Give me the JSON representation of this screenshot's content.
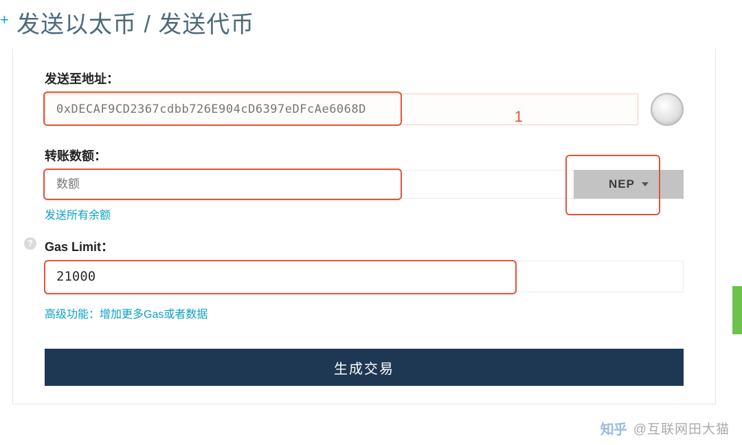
{
  "title": "发送以太币 / 发送代币",
  "address": {
    "label": "发送至地址：",
    "placeholder": "0xDECAF9CD2367cdbb726E904cD6397eDFcAe6068D"
  },
  "amount": {
    "label": "转账数额：",
    "placeholder": "数额",
    "currency": "NEP",
    "send_all_link": "发送所有余额"
  },
  "gas": {
    "label": "Gas Limit：",
    "value": "21000",
    "advanced_link": "高级功能：增加更多Gas或者数据"
  },
  "button": {
    "generate": "生成交易"
  },
  "annotation": {
    "marker1": "1"
  },
  "watermark": {
    "logo": "知乎",
    "author": "@互联网田大猫"
  },
  "colors": {
    "highlight": "#e2543a",
    "link": "#0aa0c6",
    "button_bg": "#1e3853"
  }
}
